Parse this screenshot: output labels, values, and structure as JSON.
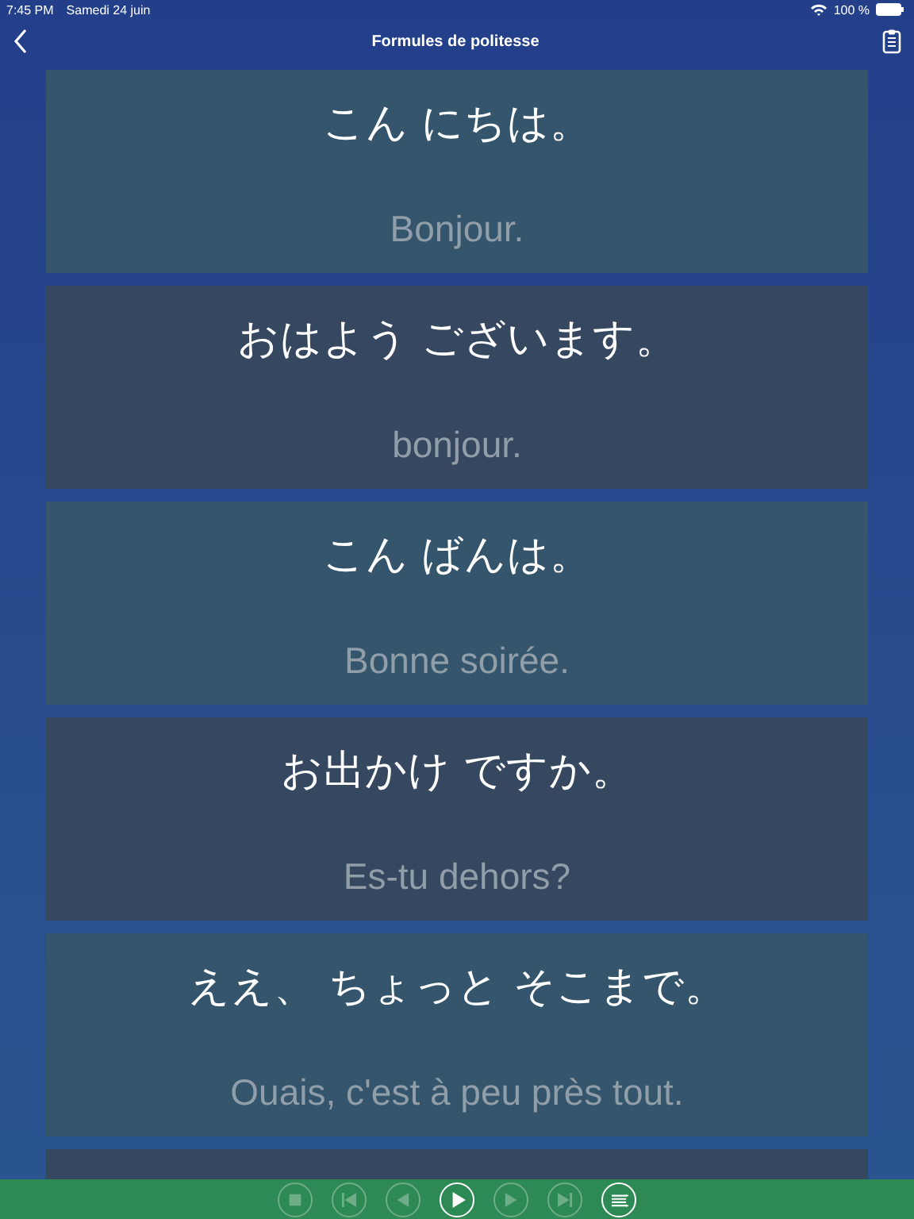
{
  "status_bar": {
    "time": "7:45 PM",
    "date": "Samedi 24 juin",
    "battery": "100 %"
  },
  "nav_bar": {
    "title": "Formules de politesse"
  },
  "cards": [
    {
      "japanese": "こん にちは。",
      "french": "Bonjour."
    },
    {
      "japanese": "おはよう ございます。",
      "french": "bonjour."
    },
    {
      "japanese": "こん ばんは。",
      "french": "Bonne soirée."
    },
    {
      "japanese": "お出かけ ですか。",
      "french": "Es-tu dehors?"
    },
    {
      "japanese": "ええ、 ちょっと そこまで。",
      "french": "Ouais, c'est à peu près tout."
    }
  ],
  "player": [
    {
      "kind": "stop",
      "disabled": true
    },
    {
      "kind": "first",
      "disabled": true
    },
    {
      "kind": "previous",
      "disabled": true
    },
    {
      "kind": "play",
      "disabled": false
    },
    {
      "kind": "next",
      "disabled": true
    },
    {
      "kind": "last",
      "disabled": true
    },
    {
      "kind": "list",
      "disabled": false
    }
  ]
}
